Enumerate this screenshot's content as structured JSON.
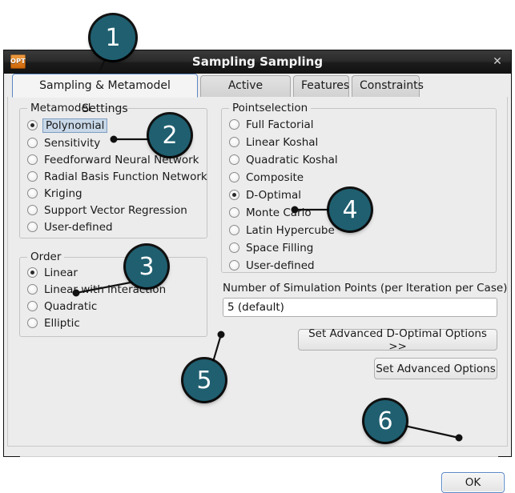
{
  "window": {
    "title": "Sampling Sampling",
    "app_icon": "OPT",
    "app_icon_label": "app-icon-opt",
    "close_label": "✕"
  },
  "tabs": [
    {
      "label": "Sampling & Metamodel Settings",
      "active": true
    },
    {
      "label": "Active Variables",
      "active": false
    },
    {
      "label": "Features",
      "active": false
    },
    {
      "label": "Constraints",
      "active": false
    }
  ],
  "metamodel": {
    "title": "Metamodel",
    "options": [
      {
        "label": "Polynomial",
        "selected": true,
        "focused": true
      },
      {
        "label": "Sensitivity",
        "selected": false,
        "focused": false
      },
      {
        "label": "Feedforward Neural Network",
        "selected": false,
        "focused": false
      },
      {
        "label": "Radial Basis Function Network",
        "selected": false,
        "focused": false
      },
      {
        "label": "Kriging",
        "selected": false,
        "focused": false
      },
      {
        "label": "Support Vector Regression",
        "selected": false,
        "focused": false
      },
      {
        "label": "User-defined",
        "selected": false,
        "focused": false
      }
    ]
  },
  "order": {
    "title": "Order",
    "options": [
      {
        "label": "Linear",
        "selected": true
      },
      {
        "label": "Linear with interaction",
        "selected": false
      },
      {
        "label": "Quadratic",
        "selected": false
      },
      {
        "label": "Elliptic",
        "selected": false
      }
    ]
  },
  "pointselection": {
    "title": "Pointselection",
    "options": [
      {
        "label": "Full Factorial",
        "selected": false
      },
      {
        "label": "Linear Koshal",
        "selected": false
      },
      {
        "label": "Quadratic Koshal",
        "selected": false
      },
      {
        "label": "Composite",
        "selected": false
      },
      {
        "label": "D-Optimal",
        "selected": true
      },
      {
        "label": "Monte Carlo",
        "selected": false
      },
      {
        "label": "Latin Hypercube",
        "selected": false
      },
      {
        "label": "Space Filling",
        "selected": false
      },
      {
        "label": "User-defined",
        "selected": false
      }
    ]
  },
  "simulation_points": {
    "label": "Number of Simulation Points (per Iteration per Case)",
    "value": "5 (default)",
    "placeholder": ""
  },
  "buttons": {
    "advanced_doptimal": "Set Advanced D-Optimal Options >>",
    "advanced_options": "Set Advanced Options",
    "ok": "OK"
  },
  "callouts": [
    {
      "number": "1"
    },
    {
      "number": "2"
    },
    {
      "number": "3"
    },
    {
      "number": "4"
    },
    {
      "number": "5"
    },
    {
      "number": "6"
    }
  ],
  "colors": {
    "badge": "#1f5f70",
    "accent_focus": "#5b87c4",
    "window_bg": "#ececec"
  }
}
